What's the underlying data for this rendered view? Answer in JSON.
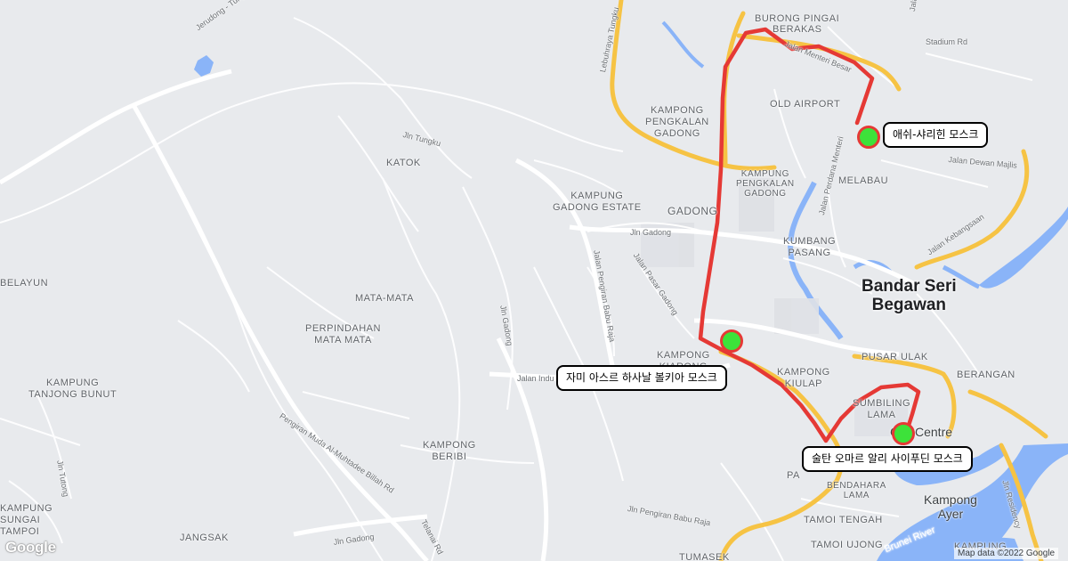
{
  "map": {
    "markers": [
      {
        "label": "애쉬-샤리힌 모스크"
      },
      {
        "label": "자미 아스르 하사날 볼키아 모스크"
      },
      {
        "label": "술탄 오마르 알리 사이푸딘 모스크"
      }
    ],
    "colors": {
      "route": "#e53935",
      "marker": "#3de23a",
      "marker_ring": "#e53935",
      "water": "#8ab4f8",
      "highway": "#f9c74f",
      "land": "#e8eaed"
    },
    "places": {
      "burong_pingai": "BURONG PINGAI",
      "berakas": "BERAKAS",
      "kampong_pengkalan_gadong": "KAMPONG\nPENGKALAN\nGADONG",
      "old_airport": "OLD AIRPORT",
      "katok": "KATOK",
      "kampung_pengkalan_gadong": "KAMPUNG\nPENGKALAN\nGADONG",
      "melabau": "MELABAU",
      "kampung_gadong_estate": "KAMPUNG\nGADONG ESTATE",
      "gadong": "GADONG",
      "kumbang_pasang": "KUMBANG\nPASANG",
      "bandar_seri_begawan": "Bandar Seri\nBegawan",
      "belayun": "BELAYUN",
      "mata_mata": "MATA-MATA",
      "perpindahan": "PERPINDAHAN\nMATA MATA",
      "pusar_ulak": "PUSAR ULAK",
      "kampong_kiarong": "KAMPONG\nKIARONG",
      "kampong_kiulap": "KAMPONG\nKIULAP",
      "berangan": "BERANGAN",
      "kampung_tanjong_bunut": "KAMPUNG\nTANJONG BUNUT",
      "sumbiling_lama": "SUMBILING\nLAMA",
      "city_centre": "City Centre",
      "kampong_beribi": "KAMPONG\nBERIBI",
      "pangsad": "PA",
      "bendahara_lama": "BENDAHARA\nLAMA",
      "kampong_ayer": "Kampong\nAyer",
      "kampung_sungai_tampoi": "KAMPUNG\nSUNGAI\nTAMPOI",
      "tamoi_tengah": "TAMOI TENGAH",
      "tamoi_ujong": "TAMOI UJONG",
      "jangsak": "JANGSAK",
      "tumasek": "TUMASEK",
      "kampung_s": "KAMPUNG"
    },
    "roads": {
      "jerudong": "Jerudong - Tungku Rd",
      "lebuhraya": "Lebuhraya Tungku",
      "menteri_besar": "Jalan Menteri Besar",
      "stadium": "Stadium Rd",
      "jln_tungku": "Jln Tungku",
      "dewan_majlis": "Jalan Dewan Majlis",
      "perdana_menteri": "Jalan Perdana Menteri",
      "kebangsaan": "Jalan Kebangsaan",
      "jln_gadong_n": "Jln Gadong",
      "babu_raja": "Jalan Pengiran Babu Raja",
      "pasar_gadong": "Jalan Pasar Gadong",
      "jln_gadong_v": "Jln Gadong",
      "jalan_indu": "Jalan Indu",
      "muhtadee": "Pengiran Muda Al-Muhtadee Billah Rd",
      "jln_tutong": "Jln Tutong",
      "babu_raja_s": "Jln Pengiran Babu Raja",
      "jln_gadong_s": "Jln Gadong",
      "telanai": "Telanai Rd",
      "residency": "Jln Residency",
      "brunei_river": "Brunei River",
      "jala": "Jala"
    },
    "footer": {
      "attribution": "Map data ©2022 Google",
      "logo": "Google"
    }
  }
}
